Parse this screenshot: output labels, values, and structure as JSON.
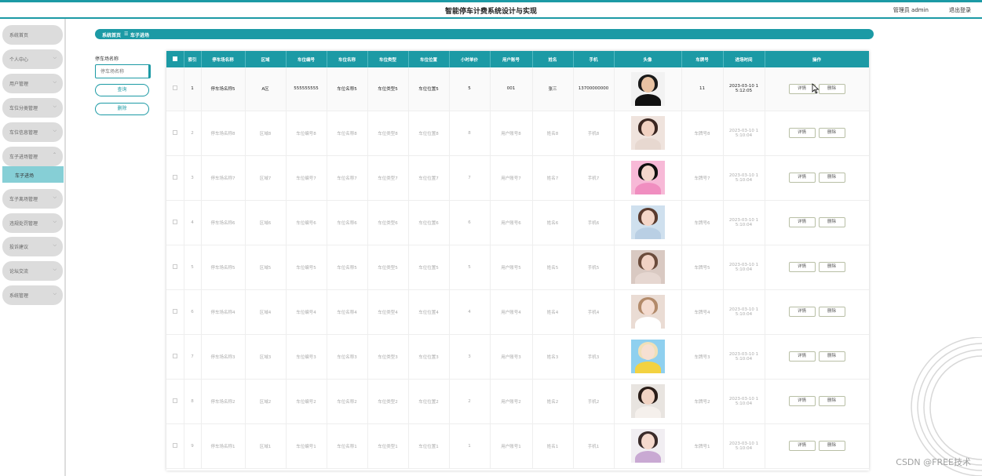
{
  "header": {
    "title": "智能停车计费系统设计与实现",
    "user": "管理员 admin",
    "logout": "退出登录"
  },
  "sidebar": {
    "items": [
      {
        "label": "系统首页"
      },
      {
        "label": "个人中心"
      },
      {
        "label": "用户管理"
      },
      {
        "label": "车位分类管理"
      },
      {
        "label": "车位信息管理"
      },
      {
        "label": "车子进场管理"
      },
      {
        "label": "车子离场管理"
      },
      {
        "label": "违规处罚管理"
      },
      {
        "label": "投诉建议"
      },
      {
        "label": "论坛交流"
      },
      {
        "label": "系统管理"
      }
    ],
    "active_sub": "车子进场"
  },
  "breadcrumb": {
    "home": "系统首页",
    "sep": "☰",
    "current": "车子进场"
  },
  "search": {
    "label": "停车场名称",
    "placeholder": "停车场名称",
    "query_button": "查询",
    "delete_button": "删除"
  },
  "table": {
    "headers": [
      "索引",
      "停车场名称",
      "区域",
      "车位编号",
      "车位名称",
      "车位类型",
      "车位位置",
      "小时单价",
      "用户账号",
      "姓名",
      "手机",
      "头像",
      "车牌号",
      "进场时间",
      "操作"
    ],
    "detail_label": "详情",
    "delete_label": "删除",
    "rows": [
      {
        "index": "1",
        "lot": "停车场名称5",
        "area": "A区",
        "slot_no": "555555555",
        "slot_name": "车位名称5",
        "slot_type": "车位类型5",
        "slot_pos": "车位位置5",
        "price": "5",
        "account": "001",
        "name": "张三",
        "phone": "13700000000",
        "plate": "11",
        "time_a": "2023-03-10 1",
        "time_b": "5:12:05"
      },
      {
        "index": "2",
        "lot": "停车场名称8",
        "area": "区域8",
        "slot_no": "车位编号8",
        "slot_name": "车位名称8",
        "slot_type": "车位类型8",
        "slot_pos": "车位位置8",
        "price": "8",
        "account": "用户账号8",
        "name": "姓名8",
        "phone": "手机8",
        "plate": "车牌号8",
        "time_a": "2023-03-10 1",
        "time_b": "5:10:04"
      },
      {
        "index": "3",
        "lot": "停车场名称7",
        "area": "区域7",
        "slot_no": "车位编号7",
        "slot_name": "车位名称7",
        "slot_type": "车位类型7",
        "slot_pos": "车位位置7",
        "price": "7",
        "account": "用户账号7",
        "name": "姓名7",
        "phone": "手机7",
        "plate": "车牌号7",
        "time_a": "2023-03-10 1",
        "time_b": "5:10:04"
      },
      {
        "index": "4",
        "lot": "停车场名称6",
        "area": "区域6",
        "slot_no": "车位编号6",
        "slot_name": "车位名称6",
        "slot_type": "车位类型6",
        "slot_pos": "车位位置6",
        "price": "6",
        "account": "用户账号6",
        "name": "姓名6",
        "phone": "手机6",
        "plate": "车牌号6",
        "time_a": "2023-03-10 1",
        "time_b": "5:10:04"
      },
      {
        "index": "5",
        "lot": "停车场名称5",
        "area": "区域5",
        "slot_no": "车位编号5",
        "slot_name": "车位名称5",
        "slot_type": "车位类型5",
        "slot_pos": "车位位置5",
        "price": "5",
        "account": "用户账号5",
        "name": "姓名5",
        "phone": "手机5",
        "plate": "车牌号5",
        "time_a": "2023-03-10 1",
        "time_b": "5:10:04"
      },
      {
        "index": "6",
        "lot": "停车场名称4",
        "area": "区域4",
        "slot_no": "车位编号4",
        "slot_name": "车位名称4",
        "slot_type": "车位类型4",
        "slot_pos": "车位位置4",
        "price": "4",
        "account": "用户账号4",
        "name": "姓名4",
        "phone": "手机4",
        "plate": "车牌号4",
        "time_a": "2023-03-10 1",
        "time_b": "5:10:04"
      },
      {
        "index": "7",
        "lot": "停车场名称3",
        "area": "区域3",
        "slot_no": "车位编号3",
        "slot_name": "车位名称3",
        "slot_type": "车位类型3",
        "slot_pos": "车位位置3",
        "price": "3",
        "account": "用户账号3",
        "name": "姓名3",
        "phone": "手机3",
        "plate": "车牌号3",
        "time_a": "2023-03-10 1",
        "time_b": "5:10:04"
      },
      {
        "index": "8",
        "lot": "停车场名称2",
        "area": "区域2",
        "slot_no": "车位编号2",
        "slot_name": "车位名称2",
        "slot_type": "车位类型2",
        "slot_pos": "车位位置2",
        "price": "2",
        "account": "用户账号2",
        "name": "姓名2",
        "phone": "手机2",
        "plate": "车牌号2",
        "time_a": "2023-03-10 1",
        "time_b": "5:10:04"
      },
      {
        "index": "9",
        "lot": "停车场名称1",
        "area": "区域1",
        "slot_no": "车位编号1",
        "slot_name": "车位名称1",
        "slot_type": "车位类型1",
        "slot_pos": "车位位置1",
        "price": "1",
        "account": "用户账号1",
        "name": "姓名1",
        "phone": "手机1",
        "plate": "车牌号1",
        "time_a": "2023-03-10 1",
        "time_b": "5:10:04"
      }
    ]
  },
  "watermark": "CSDN @FREE技术",
  "colors": {
    "accent": "#1c9aa5",
    "submenu_active": "#86cfd6",
    "menu_bg": "#dcdcdc"
  }
}
